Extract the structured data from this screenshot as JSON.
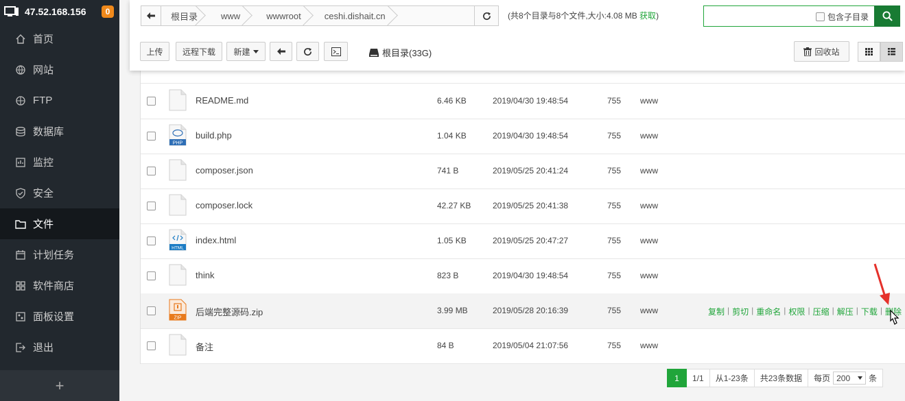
{
  "server": {
    "ip": "47.52.168.156",
    "badge": "0"
  },
  "sidebar": {
    "items": [
      {
        "label": "首页",
        "icon": "home-icon"
      },
      {
        "label": "网站",
        "icon": "globe-icon"
      },
      {
        "label": "FTP",
        "icon": "ftp-icon"
      },
      {
        "label": "数据库",
        "icon": "database-icon"
      },
      {
        "label": "监控",
        "icon": "monitor-icon"
      },
      {
        "label": "安全",
        "icon": "shield-icon"
      },
      {
        "label": "文件",
        "icon": "folder-icon"
      },
      {
        "label": "计划任务",
        "icon": "calendar-icon"
      },
      {
        "label": "软件商店",
        "icon": "grid-icon"
      },
      {
        "label": "面板设置",
        "icon": "settings-icon"
      },
      {
        "label": "退出",
        "icon": "logout-icon"
      }
    ],
    "active": "文件",
    "add": "+"
  },
  "breadcrumb": {
    "segments": [
      "根目录",
      "www",
      "wwwroot",
      "ceshi.dishait.cn"
    ]
  },
  "stats": {
    "text": "(共8个目录与8个文件,大小:4.08 MB",
    "get_label": "获取",
    "close": ")"
  },
  "search": {
    "subdir_label": "包含子目录"
  },
  "toolbar": {
    "upload": "上传",
    "remote_download": "远程下载",
    "new": "新建",
    "disk_label": "根目录(33G)",
    "recycle": "回收站"
  },
  "files": [
    {
      "name": "README.md",
      "size": "6.46 KB",
      "time": "2019/04/30 19:48:54",
      "perm": "755",
      "owner": "www",
      "type": "file"
    },
    {
      "name": "build.php",
      "size": "1.04 KB",
      "time": "2019/04/30 19:48:54",
      "perm": "755",
      "owner": "www",
      "type": "php"
    },
    {
      "name": "composer.json",
      "size": "741 B",
      "time": "2019/05/25 20:41:24",
      "perm": "755",
      "owner": "www",
      "type": "file"
    },
    {
      "name": "composer.lock",
      "size": "42.27 KB",
      "time": "2019/05/25 20:41:38",
      "perm": "755",
      "owner": "www",
      "type": "file"
    },
    {
      "name": "index.html",
      "size": "1.05 KB",
      "time": "2019/05/25 20:47:27",
      "perm": "755",
      "owner": "www",
      "type": "html"
    },
    {
      "name": "think",
      "size": "823 B",
      "time": "2019/04/30 19:48:54",
      "perm": "755",
      "owner": "www",
      "type": "file"
    },
    {
      "name": "后端完整源码.zip",
      "size": "3.99 MB",
      "time": "2019/05/28 20:16:39",
      "perm": "755",
      "owner": "www",
      "type": "zip"
    },
    {
      "name": "备注",
      "size": "84 B",
      "time": "2019/05/04 21:07:56",
      "perm": "755",
      "owner": "www",
      "type": "file"
    }
  ],
  "row_ops": [
    "复制",
    "剪切",
    "重命名",
    "权限",
    "压缩",
    "解压",
    "下载",
    "删除"
  ],
  "icon_labels": {
    "php": "PHP",
    "html": "HTML",
    "zip": "ZIP"
  },
  "pager": {
    "current": "1",
    "pages": "1/1",
    "range": "从1-23条",
    "total": "共23条数据",
    "per_label": "每页",
    "per_value": "200",
    "unit": "条"
  },
  "colors": {
    "accent": "#20a53a",
    "sidebar": "#22282e",
    "badge": "#f0891b",
    "php": "#2f6fb6",
    "html": "#1c7cc4",
    "zip": "#e87a1c"
  }
}
